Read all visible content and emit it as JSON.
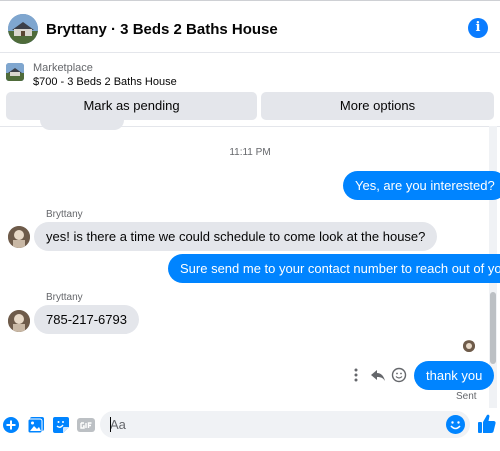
{
  "header": {
    "title": "Bryttany · 3 Beds 2 Baths House",
    "info_glyph": "i"
  },
  "listing": {
    "kind": "Marketplace",
    "description": "$700 - 3 Beds 2 Baths House"
  },
  "actions": {
    "mark_pending": "Mark as pending",
    "more_options": "More options"
  },
  "chat": {
    "timestamp": "11:11 PM",
    "messages": [
      {
        "direction": "outgoing",
        "text": "Yes, are you interested?"
      },
      {
        "direction": "incoming",
        "sender": "Bryttany",
        "text": "yes! is there a time we could schedule to come look at the house?"
      },
      {
        "direction": "outgoing",
        "text": "Sure send me to your contact number to reach out of you"
      },
      {
        "direction": "incoming",
        "sender": "Bryttany",
        "text": "785-217-6793"
      },
      {
        "direction": "outgoing",
        "text": "thank you"
      }
    ],
    "status": "Sent",
    "message_actions": [
      "more-vertical-icon",
      "reply-icon",
      "react-icon"
    ]
  },
  "composer": {
    "placeholder": "Aa",
    "icons": [
      "plus-icon",
      "photo-icon",
      "sticker-icon",
      "gif-icon",
      "emoji-icon",
      "thumbs-up-icon"
    ]
  },
  "colors": {
    "accent": "#0084ff",
    "incoming_bubble": "#e4e6eb",
    "button_bg": "#e4e6eb",
    "secondary_text": "#65676b"
  }
}
